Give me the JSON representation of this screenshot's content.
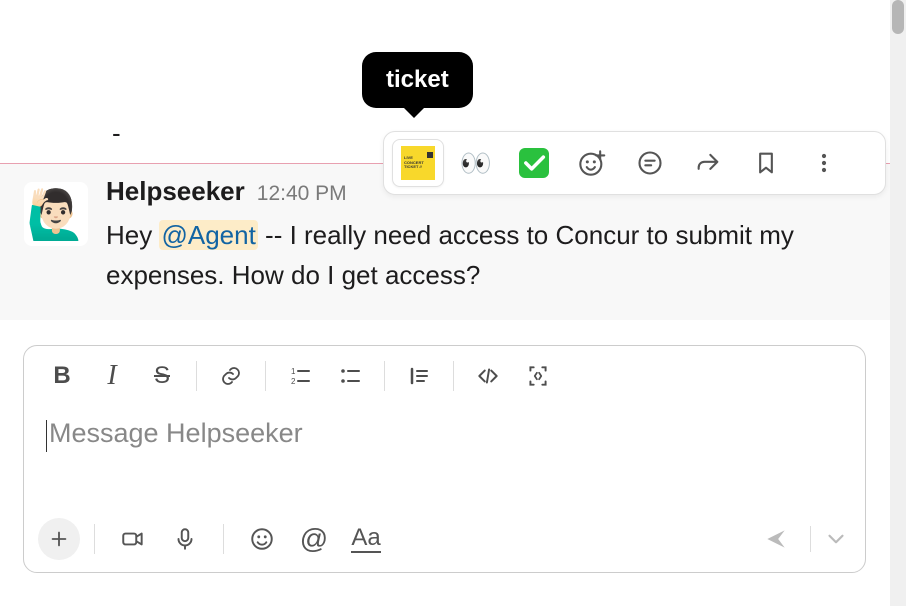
{
  "tooltip": {
    "label": "ticket"
  },
  "action_toolbar": {
    "ticket_icon": "ticket",
    "eyes_emoji": "👀",
    "check_icon": "white-check-mark",
    "add_reaction": "add-reaction",
    "thread": "thread",
    "share": "share",
    "bookmark": "bookmark",
    "more": "more-actions"
  },
  "message": {
    "avatar_emoji": "🙋🏻‍♂️",
    "sender": "Helpseeker",
    "timestamp": "12:40 PM",
    "text_pre": "Hey ",
    "mention": "@Agent",
    "text_post": " -- I really need access to Concur to submit my expenses. How do I get access?"
  },
  "prior_fragment": "-",
  "composer": {
    "placeholder": "Message Helpseeker",
    "format": {
      "bold": "B",
      "italic": "I",
      "strike": "S",
      "link": "link",
      "ordered_list": "ordered-list",
      "bullet_list": "bullet-list",
      "blockquote": "blockquote",
      "code": "code",
      "code_block": "code-block"
    },
    "bottom": {
      "plus": "+",
      "video": "video",
      "mic": "microphone",
      "emoji": "emoji",
      "mention": "@",
      "formatting": "Aa",
      "send": "send",
      "send_options": "send-options"
    }
  }
}
